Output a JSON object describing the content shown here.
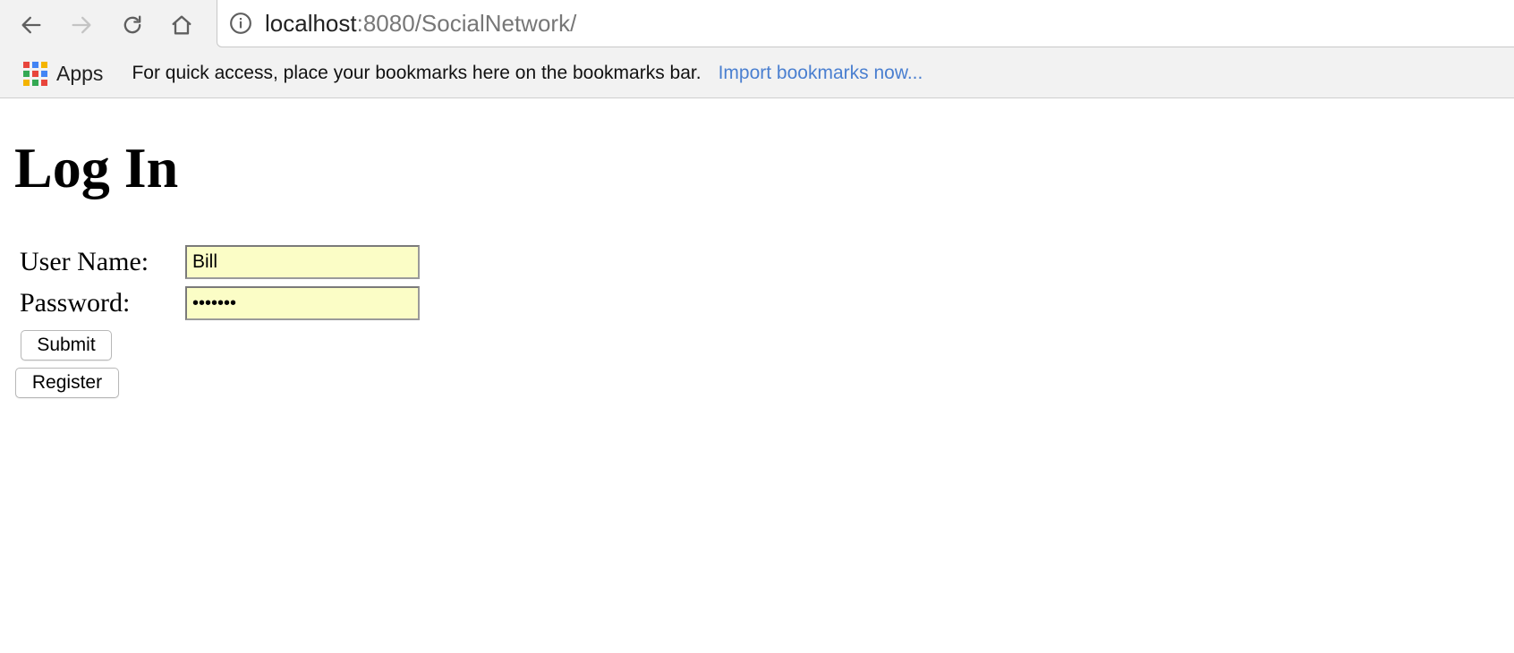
{
  "browser": {
    "url_host": "localhost",
    "url_rest": ":8080/SocialNetwork/",
    "bookmarks_bar": {
      "apps_label": "Apps",
      "hint": "For quick access, place your bookmarks here on the bookmarks bar.",
      "import_link": "Import bookmarks now..."
    },
    "icons": {
      "back": "back-arrow-icon",
      "forward": "forward-arrow-icon",
      "reload": "reload-icon",
      "home": "home-icon",
      "site_info": "info-icon",
      "apps": "apps-grid-icon"
    },
    "apps_icon_colors": [
      "#e8453c",
      "#4285f4",
      "#f4b400",
      "#34a853",
      "#e8453c",
      "#4285f4",
      "#f4b400",
      "#34a853",
      "#e8453c"
    ],
    "link_color": "#4a7fd0"
  },
  "page": {
    "title": "Log In",
    "form": {
      "username_label": "User Name:",
      "username_value": "Bill",
      "password_label": "Password:",
      "password_value": "•••••••",
      "input_background": "#fbfdc6",
      "submit_label": "Submit",
      "register_label": "Register"
    }
  }
}
